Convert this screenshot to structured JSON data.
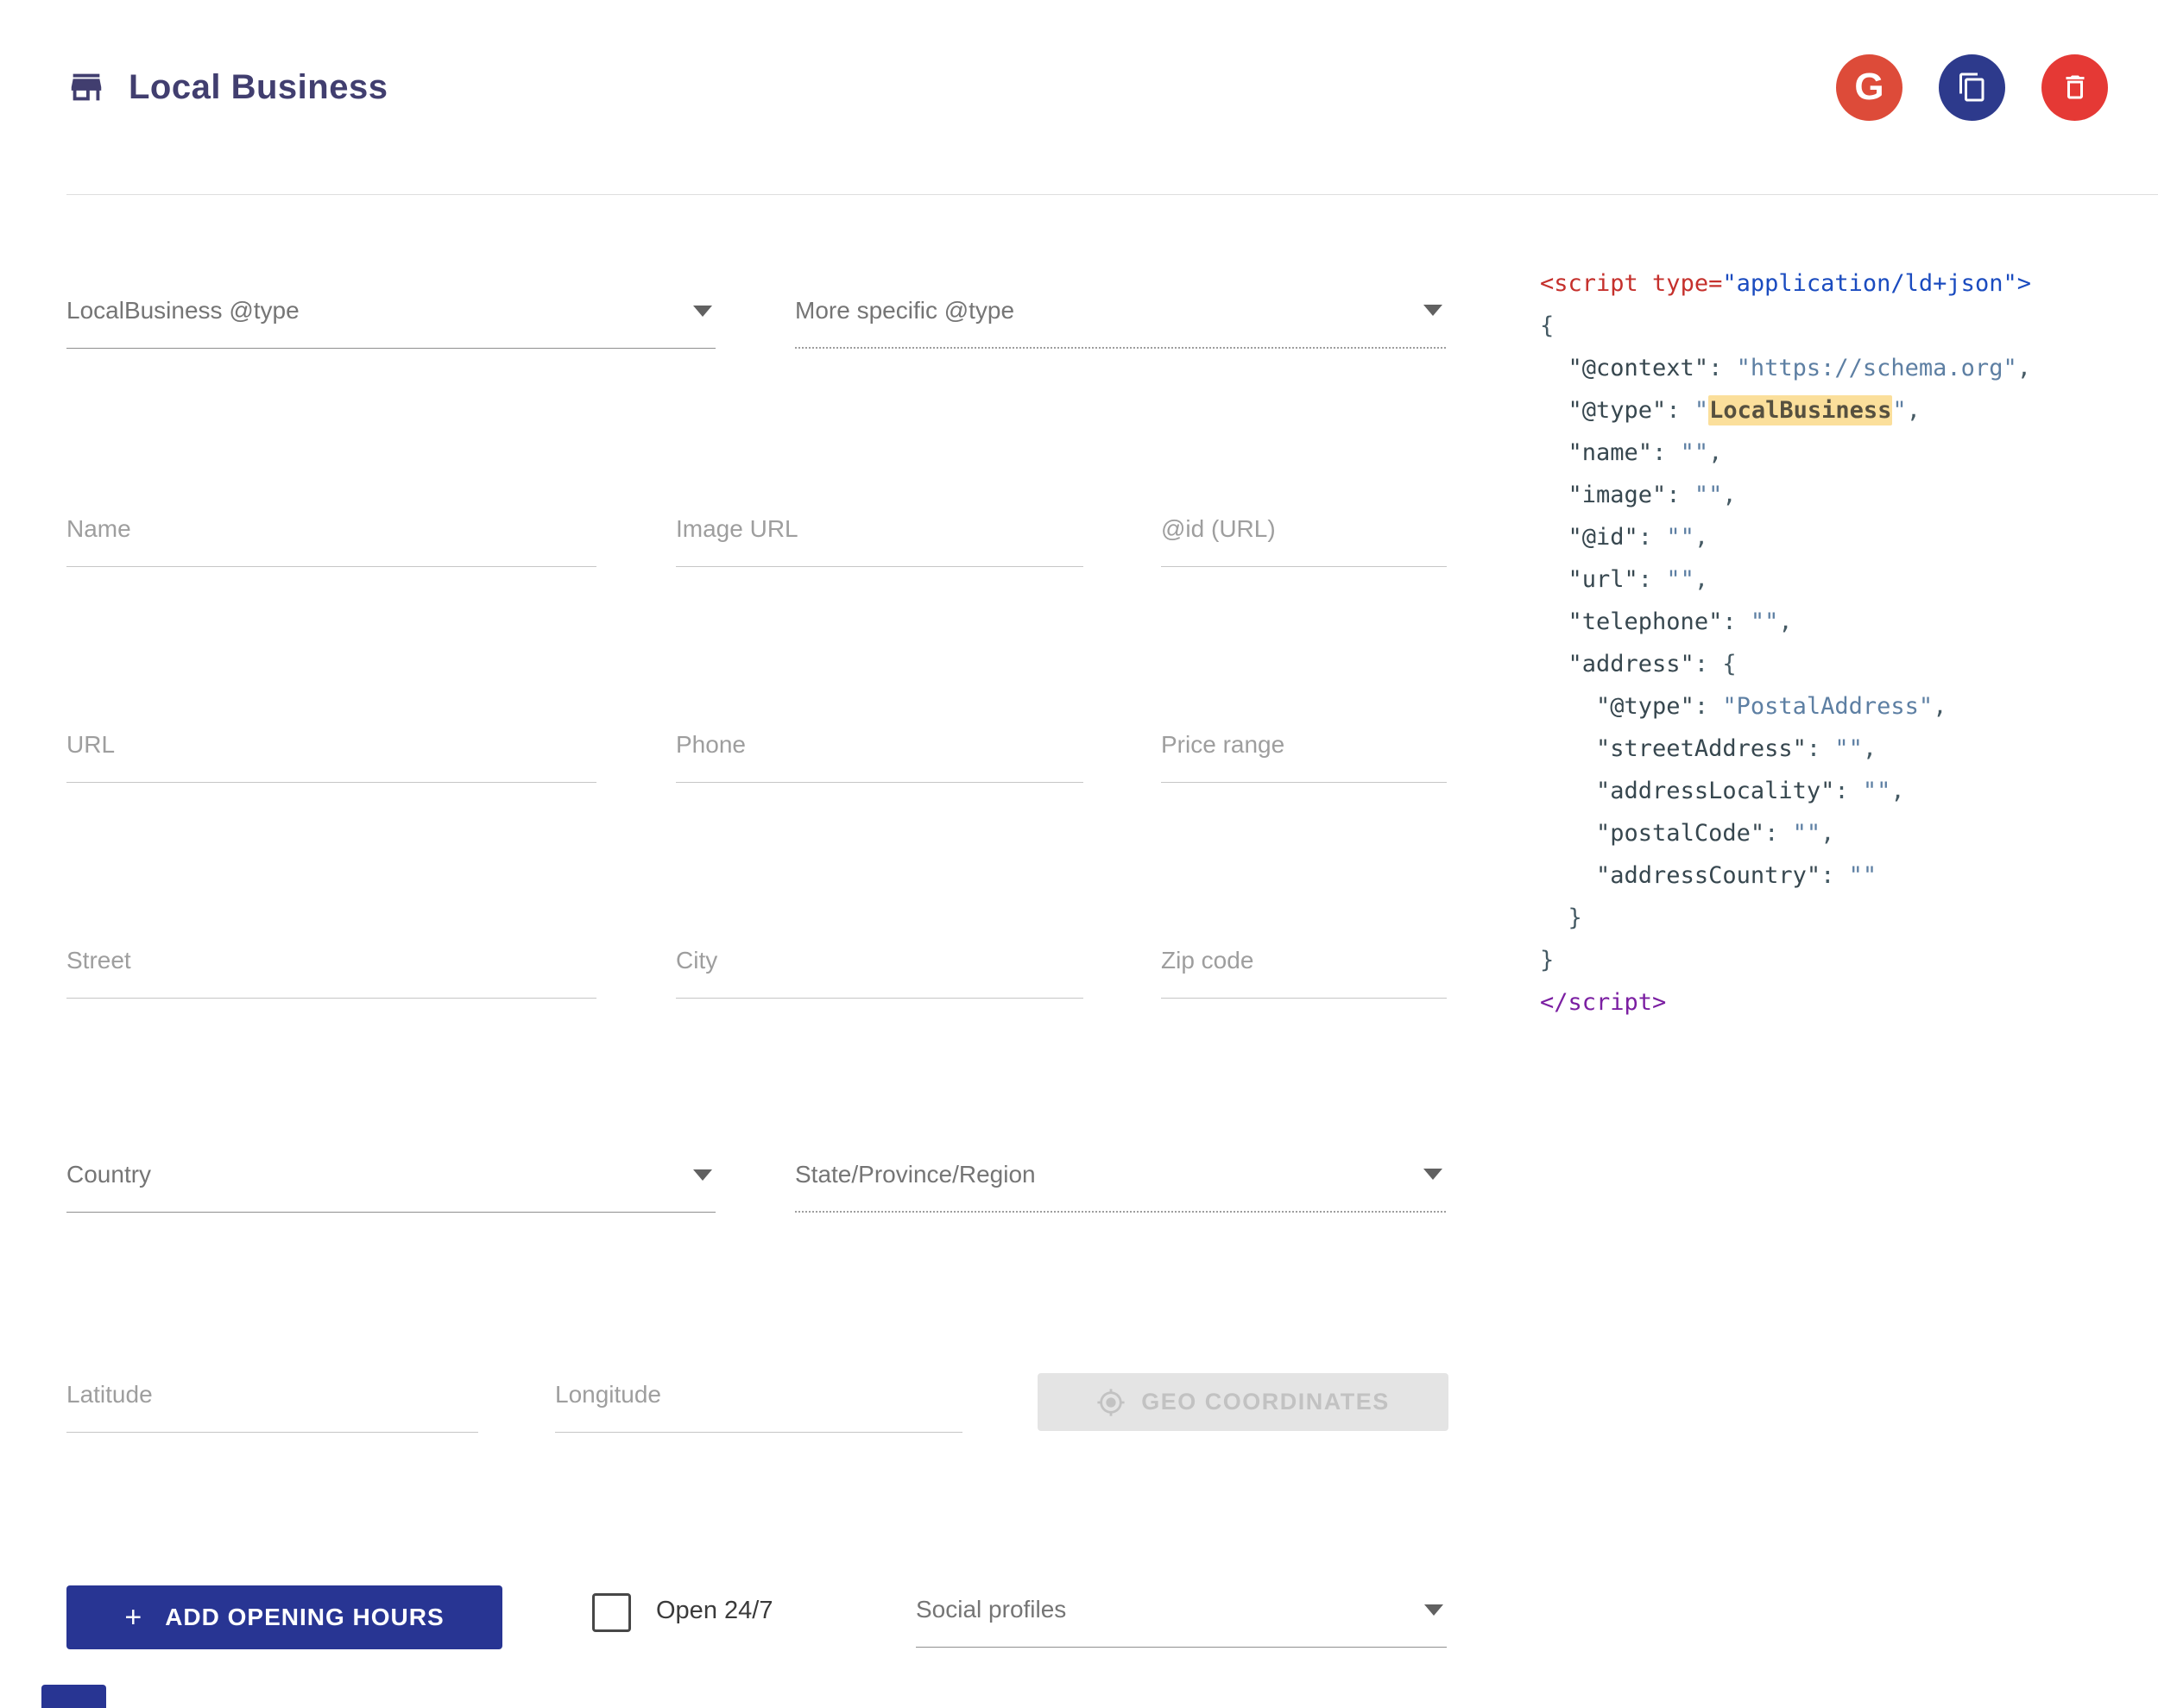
{
  "header": {
    "title": "Local Business",
    "google_button_label": "G"
  },
  "form": {
    "type_select": "LocalBusiness @type",
    "more_specific_select": "More specific @type",
    "name": "Name",
    "image_url": "Image URL",
    "id_url": "@id (URL)",
    "url": "URL",
    "phone": "Phone",
    "price_range": "Price range",
    "street": "Street",
    "city": "City",
    "zip_code": "Zip code",
    "country": "Country",
    "state": "State/Province/Region",
    "latitude": "Latitude",
    "longitude": "Longitude",
    "geo_button": "GEO COORDINATES",
    "plus": "+",
    "add_opening_hours_button": "ADD OPENING HOURS",
    "open_247": "Open 24/7",
    "social_profiles": "Social profiles"
  },
  "colors": {
    "title_navy": "#413e6f",
    "accent_navy": "#283593",
    "google_red": "#dd4b39",
    "copy_indigo": "#2d3a8c",
    "delete_red": "#e53935",
    "highlight_yellow": "#fbdf9b"
  },
  "code": {
    "lines": [
      [
        {
          "c": "tag",
          "t": "<script"
        },
        {
          "c": "tag",
          "t": " type="
        },
        {
          "c": "aval",
          "t": "\"application/ld+json\""
        },
        {
          "c": "aval",
          "t": ">"
        }
      ],
      [
        {
          "c": "pun",
          "t": "{"
        }
      ],
      [
        {
          "c": "pun",
          "t": "  "
        },
        {
          "c": "key",
          "t": "\"@context\""
        },
        {
          "c": "pun",
          "t": ": "
        },
        {
          "c": "str",
          "t": "\"https://schema.org\""
        },
        {
          "c": "pun",
          "t": ","
        }
      ],
      [
        {
          "c": "pun",
          "t": "  "
        },
        {
          "c": "key",
          "t": "\"@type\""
        },
        {
          "c": "pun",
          "t": ": "
        },
        {
          "c": "str",
          "t": "\""
        },
        {
          "c": "hl",
          "t": "LocalBusiness"
        },
        {
          "c": "str",
          "t": "\""
        },
        {
          "c": "pun",
          "t": ","
        }
      ],
      [
        {
          "c": "pun",
          "t": "  "
        },
        {
          "c": "key",
          "t": "\"name\""
        },
        {
          "c": "pun",
          "t": ": "
        },
        {
          "c": "str",
          "t": "\"\""
        },
        {
          "c": "pun",
          "t": ","
        }
      ],
      [
        {
          "c": "pun",
          "t": "  "
        },
        {
          "c": "key",
          "t": "\"image\""
        },
        {
          "c": "pun",
          "t": ": "
        },
        {
          "c": "str",
          "t": "\"\""
        },
        {
          "c": "pun",
          "t": ","
        }
      ],
      [
        {
          "c": "pun",
          "t": "  "
        },
        {
          "c": "key",
          "t": "\"@id\""
        },
        {
          "c": "pun",
          "t": ": "
        },
        {
          "c": "str",
          "t": "\"\""
        },
        {
          "c": "pun",
          "t": ","
        }
      ],
      [
        {
          "c": "pun",
          "t": "  "
        },
        {
          "c": "key",
          "t": "\"url\""
        },
        {
          "c": "pun",
          "t": ": "
        },
        {
          "c": "str",
          "t": "\"\""
        },
        {
          "c": "pun",
          "t": ","
        }
      ],
      [
        {
          "c": "pun",
          "t": "  "
        },
        {
          "c": "key",
          "t": "\"telephone\""
        },
        {
          "c": "pun",
          "t": ": "
        },
        {
          "c": "str",
          "t": "\"\""
        },
        {
          "c": "pun",
          "t": ","
        }
      ],
      [
        {
          "c": "pun",
          "t": "  "
        },
        {
          "c": "key",
          "t": "\"address\""
        },
        {
          "c": "pun",
          "t": ": {"
        }
      ],
      [
        {
          "c": "pun",
          "t": "    "
        },
        {
          "c": "key",
          "t": "\"@type\""
        },
        {
          "c": "pun",
          "t": ": "
        },
        {
          "c": "str",
          "t": "\"PostalAddress\""
        },
        {
          "c": "pun",
          "t": ","
        }
      ],
      [
        {
          "c": "pun",
          "t": "    "
        },
        {
          "c": "key",
          "t": "\"streetAddress\""
        },
        {
          "c": "pun",
          "t": ": "
        },
        {
          "c": "str",
          "t": "\"\""
        },
        {
          "c": "pun",
          "t": ","
        }
      ],
      [
        {
          "c": "pun",
          "t": "    "
        },
        {
          "c": "key",
          "t": "\"addressLocality\""
        },
        {
          "c": "pun",
          "t": ": "
        },
        {
          "c": "str",
          "t": "\"\""
        },
        {
          "c": "pun",
          "t": ","
        }
      ],
      [
        {
          "c": "pun",
          "t": "    "
        },
        {
          "c": "key",
          "t": "\"postalCode\""
        },
        {
          "c": "pun",
          "t": ": "
        },
        {
          "c": "str",
          "t": "\"\""
        },
        {
          "c": "pun",
          "t": ","
        }
      ],
      [
        {
          "c": "pun",
          "t": "    "
        },
        {
          "c": "key",
          "t": "\"addressCountry\""
        },
        {
          "c": "pun",
          "t": ": "
        },
        {
          "c": "str",
          "t": "\"\""
        }
      ],
      [
        {
          "c": "pun",
          "t": "  }"
        }
      ],
      [
        {
          "c": "pun",
          "t": "}"
        }
      ],
      [
        {
          "c": "ctag",
          "t": "</script>"
        }
      ]
    ]
  }
}
